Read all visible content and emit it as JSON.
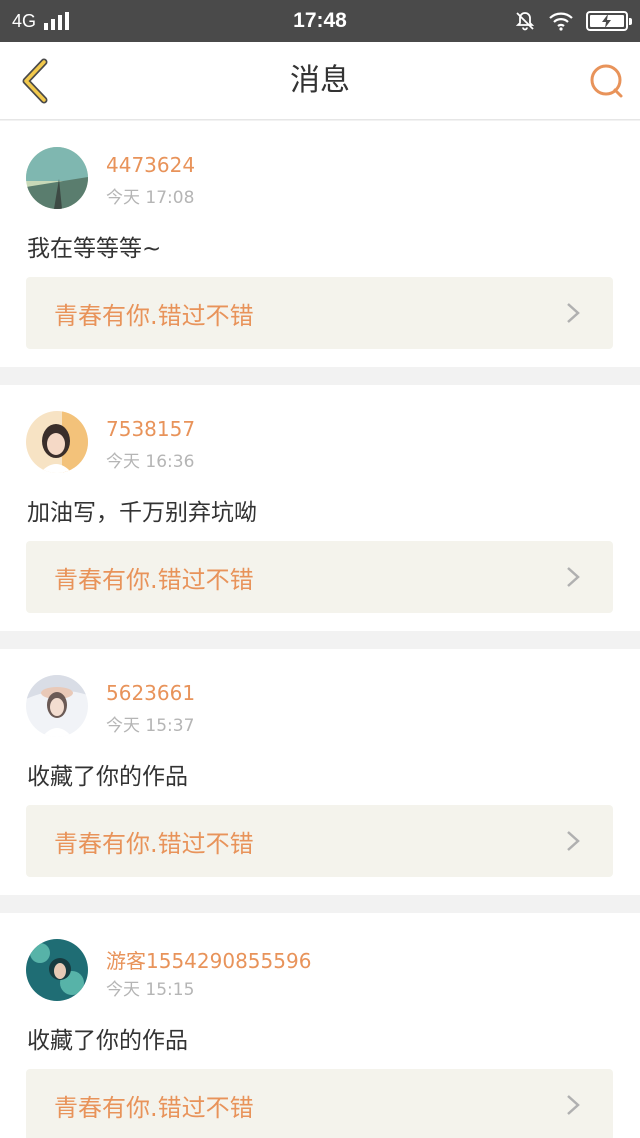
{
  "status_bar": {
    "network": "4G",
    "time": "17:48"
  },
  "header": {
    "title": "消息"
  },
  "messages": [
    {
      "username": "4473624",
      "time": "今天 17:08",
      "text": "我在等等等~",
      "work_title": "青春有你.错过不错",
      "avatar_colors": [
        "#7fb7b0",
        "#c8d9b8",
        "#5a7d6e"
      ]
    },
    {
      "username": "7538157",
      "time": "今天 16:36",
      "text": "加油写，千万别弃坑呦",
      "work_title": "青春有你.错过不错",
      "avatar_colors": [
        "#f3c27a",
        "#f7e3c4",
        "#3a2e2a"
      ]
    },
    {
      "username": "5623661",
      "time": "今天 15:37",
      "text": "收藏了你的作品",
      "work_title": "青春有你.错过不错",
      "avatar_colors": [
        "#d9dde6",
        "#f1f3f7",
        "#6b5a55"
      ]
    },
    {
      "username": "游客1554290855596",
      "time": "今天 15:15",
      "text": "收藏了你的作品",
      "work_title": "青春有你.错过不错",
      "avatar_colors": [
        "#1f6d74",
        "#57b3a8",
        "#173a3f"
      ]
    }
  ],
  "colors": {
    "accent": "#e8935a",
    "back_icon": "#f2c94c",
    "status_bar": "#4a4a4a"
  }
}
